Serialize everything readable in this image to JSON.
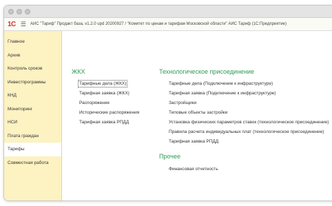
{
  "window": {
    "app_title": "АИС \"Тариф\" Продакт база, v1.2.0 upd 20200927 / \"Комитет по ценам и тарифам Московской области\" АИС Тариф  (1С:Предприятие)",
    "logo_text": "1С",
    "menu_icon": "hamburger-icon"
  },
  "sidebar": {
    "items": [
      {
        "label": "Главное"
      },
      {
        "label": "Архив"
      },
      {
        "label": "Контроль сроков"
      },
      {
        "label": "Инвестпрограммы"
      },
      {
        "label": "КНД"
      },
      {
        "label": "Мониторинг"
      },
      {
        "label": "НСИ"
      },
      {
        "label": "Плата граждан"
      },
      {
        "label": "Тарифы"
      },
      {
        "label": "Совместная работа"
      }
    ],
    "active": "Тарифы"
  },
  "groups": {
    "zhkh": {
      "title": "ЖКХ",
      "links": [
        "Тарифные дела (ЖКХ)",
        "Тарифная заявка (ЖКХ)",
        "Распоряжение",
        "Исторические распоряжения",
        "Тарифная заявка РПДД"
      ]
    },
    "tech": {
      "title": "Технологическое присоединение",
      "links": [
        "Тарифные дела (Подключение к инфраструктуре)",
        "Тарифная заявка (Подключение к инфраструктуре)",
        "Застройщики",
        "Типовые объекты застройки",
        "Установка физических параметров ставок (технологическое присоединение)",
        "Правила расчета индивидуальных плат (технологическое присоединение)",
        "Тарифная заявка РПДД"
      ]
    },
    "other": {
      "title": "Прочее",
      "links": [
        "Финансовая отчетность"
      ]
    }
  }
}
